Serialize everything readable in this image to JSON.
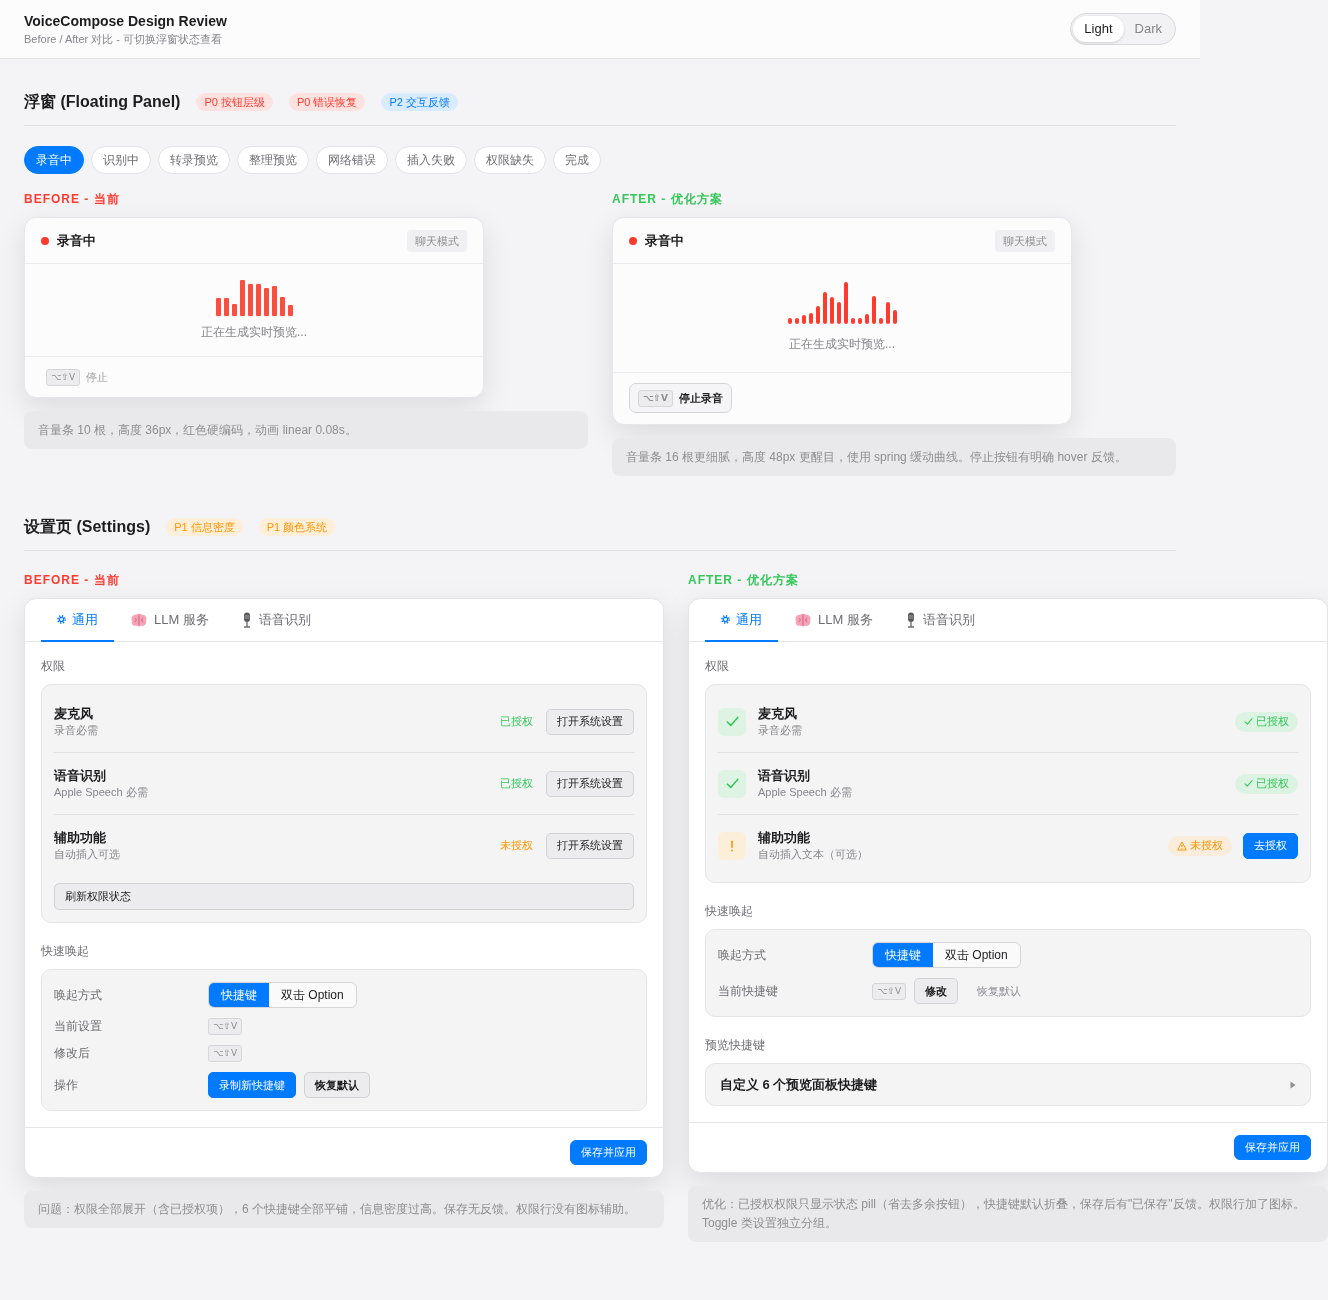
{
  "header": {
    "title": "VoiceCompose Design Review",
    "subtitle": "Before / After 对比 - 可切换浮窗状态查看",
    "theme_options": [
      {
        "label": "Light",
        "selected": true
      },
      {
        "label": "Dark",
        "selected": false
      }
    ]
  },
  "floating_section": {
    "title": "浮窗 (Floating Panel)",
    "tags": [
      {
        "label": "P0 按钮层级",
        "color": "#ff3b30"
      },
      {
        "label": "P0 错误恢复",
        "color": "#ff3b30"
      },
      {
        "label": "P2 交互反馈",
        "color": "#007aff"
      }
    ],
    "states": [
      {
        "label": "录音中",
        "selected": true
      },
      {
        "label": "识别中",
        "selected": false
      },
      {
        "label": "转录预览",
        "selected": false
      },
      {
        "label": "整理预览",
        "selected": false
      },
      {
        "label": "网络错误",
        "selected": false
      },
      {
        "label": "插入失败",
        "selected": false
      },
      {
        "label": "权限缺失",
        "selected": false
      },
      {
        "label": "完成",
        "selected": false
      }
    ],
    "columns": [
      {
        "kind": "before",
        "heading": "BEFORE - 当前",
        "panel": {
          "status": "录音中",
          "mode": "聊天模式",
          "preview": "正在生成实时预览...",
          "shortcut": "⌥⇧V",
          "stop": "停止"
        },
        "note": "音量条 10 根，高度 36px，红色硬编码，动画 linear 0.08s。"
      },
      {
        "kind": "after",
        "heading": "AFTER - 优化方案",
        "panel": {
          "status": "录音中",
          "mode": "聊天模式",
          "preview": "正在生成实时预览...",
          "shortcut": "⌥⇧V",
          "stop": "停止录音"
        },
        "note": "音量条 16 根更细腻，高度 48px 更醒目，使用 spring 缓动曲线。停止按钮有明确 hover 反馈。"
      }
    ]
  },
  "settings_section": {
    "title": "设置页 (Settings)",
    "tags": [
      {
        "label": "P1 信息密度",
        "color": "#ff9500"
      },
      {
        "label": "P1 颜色系统",
        "color": "#ff9500"
      }
    ],
    "columns": [
      {
        "kind": "before",
        "heading": "BEFORE - 当前",
        "panel": {
          "tabs": [
            {
              "label": "通用",
              "selected": true
            },
            {
              "label": "LLM 服务",
              "selected": false
            },
            {
              "label": "语音识别",
              "selected": false
            }
          ],
          "groups": [
            {
              "kind": "permissions",
              "title": "权限",
              "items": [
                {
                  "name": "麦克风",
                  "detail": "录音必需",
                  "granted": true,
                  "status": "已授权",
                  "action": "打开系统设置"
                },
                {
                  "name": "语音识别",
                  "detail": "Apple Speech 必需",
                  "granted": true,
                  "status": "已授权",
                  "action": "打开系统设置"
                },
                {
                  "name": "辅助功能",
                  "detail": "自动插入可选",
                  "granted": false,
                  "status": "未授权",
                  "action": "打开系统设置"
                }
              ],
              "footer_button": "刷新权限状态"
            },
            {
              "kind": "options",
              "title": "快速唤起",
              "rows": [
                {
                  "kind": "segmented",
                  "label": "唤起方式",
                  "options": [
                    {
                      "label": "快捷键",
                      "selected": true
                    },
                    {
                      "label": "双击 Option",
                      "selected": false
                    }
                  ]
                },
                {
                  "kind": "controls",
                  "label": "当前设置",
                  "keys": "⌥⇧V"
                },
                {
                  "kind": "controls",
                  "label": "修改后",
                  "keys": "⌥⇧V"
                },
                {
                  "kind": "controls",
                  "label": "操作",
                  "buttons": [
                    {
                      "kind": "primary",
                      "label": "录制新快捷键"
                    },
                    {
                      "kind": "secondary",
                      "label": "恢复默认"
                    }
                  ]
                }
              ]
            }
          ],
          "save_button": "保存并应用"
        },
        "note": "问题：权限全部展开（含已授权项），6 个快捷键全部平铺，信息密度过高。保存无反馈。权限行没有图标辅助。"
      },
      {
        "kind": "after",
        "heading": "AFTER - 优化方案",
        "panel": {
          "tabs": [
            {
              "label": "通用",
              "selected": true
            },
            {
              "label": "LLM 服务",
              "selected": false
            },
            {
              "label": "语音识别",
              "selected": false
            }
          ],
          "groups": [
            {
              "kind": "permissions",
              "title": "权限",
              "items": [
                {
                  "name": "麦克风",
                  "detail": "录音必需",
                  "granted": true,
                  "status": "已授权"
                },
                {
                  "name": "语音识别",
                  "detail": "Apple Speech 必需",
                  "granted": true,
                  "status": "已授权"
                },
                {
                  "name": "辅助功能",
                  "detail": "自动插入文本（可选）",
                  "granted": false,
                  "status": "未授权",
                  "action": "去授权"
                }
              ]
            },
            {
              "kind": "options",
              "title": "快速唤起",
              "rows": [
                {
                  "kind": "segmented",
                  "label": "唤起方式",
                  "options": [
                    {
                      "label": "快捷键",
                      "selected": true
                    },
                    {
                      "label": "双击 Option",
                      "selected": false
                    }
                  ]
                },
                {
                  "kind": "controls",
                  "label": "当前快捷键",
                  "keys": "⌥⇧V",
                  "buttons": [
                    {
                      "kind": "secondary",
                      "label": "修改"
                    },
                    {
                      "kind": "link",
                      "label": "恢复默认"
                    }
                  ]
                }
              ]
            },
            {
              "kind": "disclosure",
              "title": "预览快捷键",
              "label": "自定义 6 个预览面板快捷键",
              "expanded": false
            }
          ],
          "save_button": "保存并应用"
        },
        "note": "优化：已授权权限只显示状态 pill（省去多余按钮），快捷键默认折叠，保存后有\"已保存\"反馈。权限行加了图标。Toggle 类设置独立分组。"
      }
    ]
  }
}
